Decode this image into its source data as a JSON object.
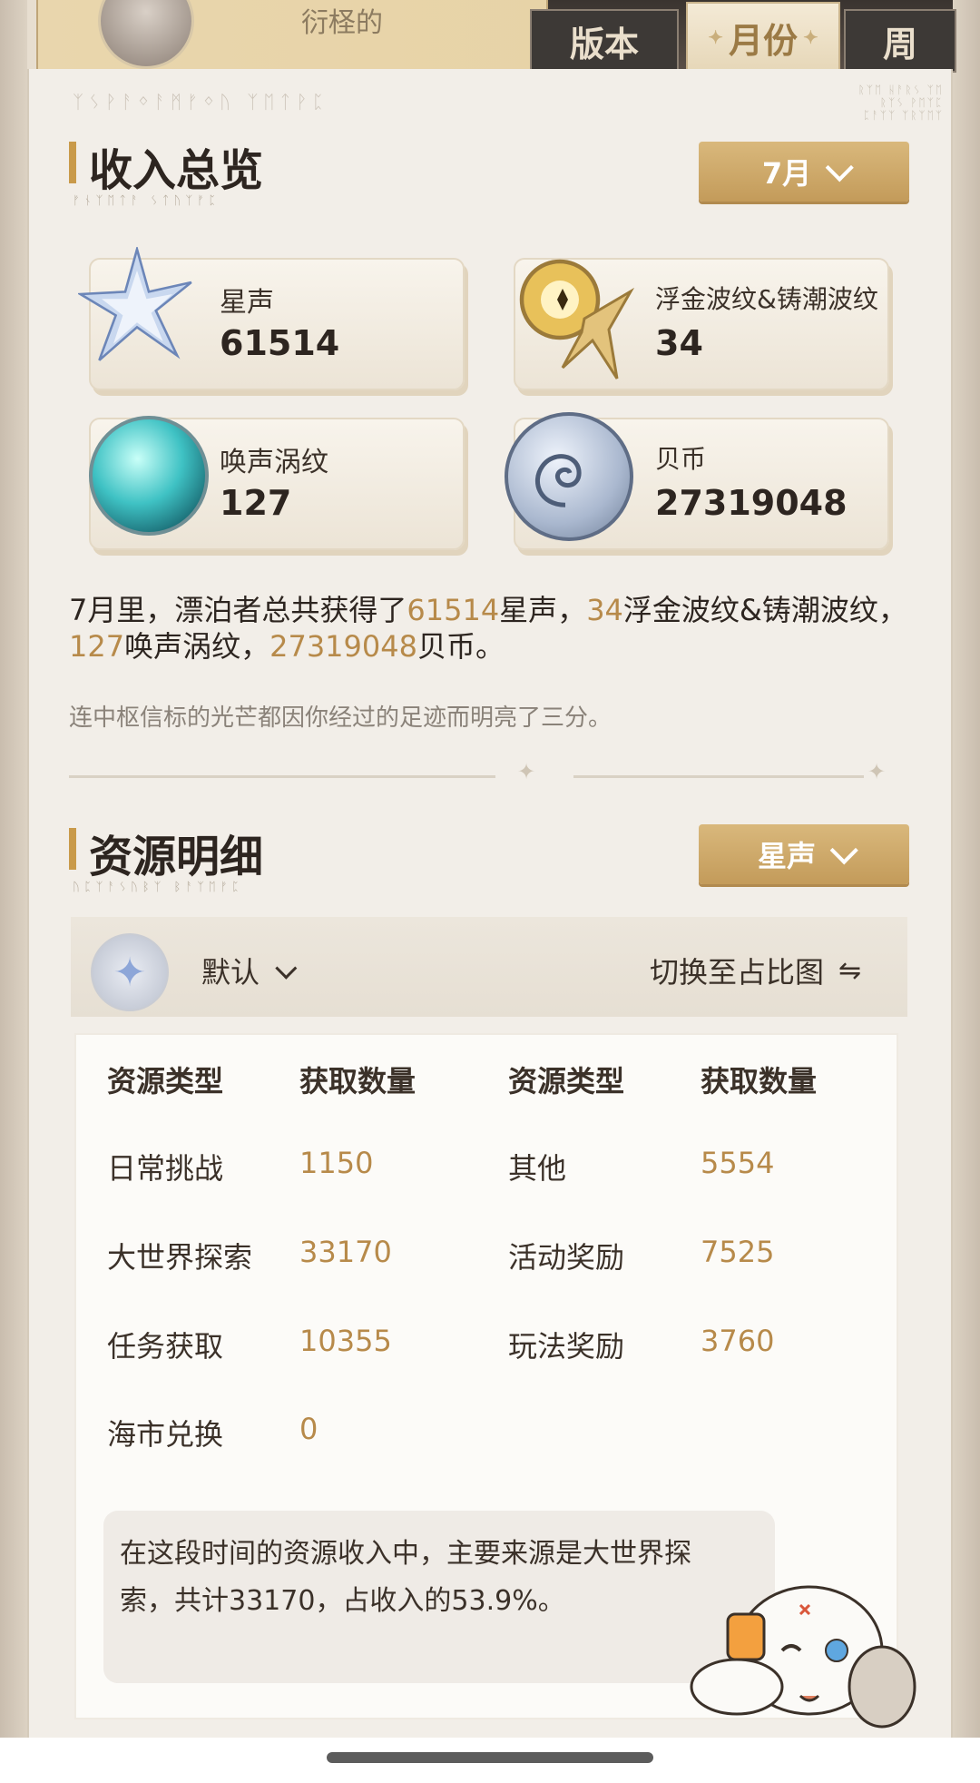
{
  "header": {
    "username": "衍柽的",
    "tabs": [
      {
        "label": "版本"
      },
      {
        "label": "月份"
      },
      {
        "label": "周"
      }
    ]
  },
  "glyph_decor": "ᛉᛊᚹᚨᛜᚨᛗᚠᛜᚢ ᛉᛖᛏᚹᛈ",
  "income": {
    "title": "收入总览",
    "subtitle_glyph": "ᚠᚾᛉᛖᛏᚨ ᛊᛏᚢᛉᚠᛈ",
    "month_dropdown": "7月",
    "cards": [
      {
        "name": "星声",
        "value": "61514",
        "icon": "astrite-star-icon"
      },
      {
        "name": "浮金波纹&铸潮波纹",
        "value": "34",
        "icon": "lustrous-tide-icon"
      },
      {
        "name": "唤声涡纹",
        "value": "127",
        "icon": "radiant-tide-icon"
      },
      {
        "name": "贝币",
        "value": "27319048",
        "icon": "shell-credit-icon"
      }
    ],
    "summary": {
      "p1": "7月里，漂泊者总共获得了",
      "v1": "61514",
      "p2": "星声，",
      "v2": "34",
      "p3": "浮金波纹&铸潮波纹，",
      "v3": "127",
      "p4": "唤声涡纹，",
      "v4": "27319048",
      "p5": "贝币。"
    },
    "flavor": "连中枢信标的光芒都因你经过的足迹而明亮了三分。"
  },
  "details": {
    "title": "资源明细",
    "subtitle_glyph": "ᚢᛈᛉᚨᛊᚢᛒᛉ ᛒᚨᛉᛖᚠᛈ",
    "resource_dropdown": "星声",
    "filter_label": "默认",
    "switch_label": "切换至占比图",
    "headers": [
      "资源类型",
      "获取数量",
      "资源类型",
      "获取数量"
    ],
    "left_rows": [
      {
        "label": "日常挑战",
        "value": "1150"
      },
      {
        "label": "大世界探索",
        "value": "33170"
      },
      {
        "label": "任务获取",
        "value": "10355"
      },
      {
        "label": "海市兑换",
        "value": "0"
      }
    ],
    "right_rows": [
      {
        "label": "其他",
        "value": "5554"
      },
      {
        "label": "活动奖励",
        "value": "7525"
      },
      {
        "label": "玩法奖励",
        "value": "3760"
      }
    ],
    "note": "在这段时间的资源收入中，主要来源是大世界探索，共计33170，占收入的53.9%。"
  },
  "colors": {
    "accent_gold": "#b78a4a",
    "dropdown_gold": "#c39b5a",
    "panel_bg": "#f2eee8",
    "tab_dark": "#3d3936"
  }
}
